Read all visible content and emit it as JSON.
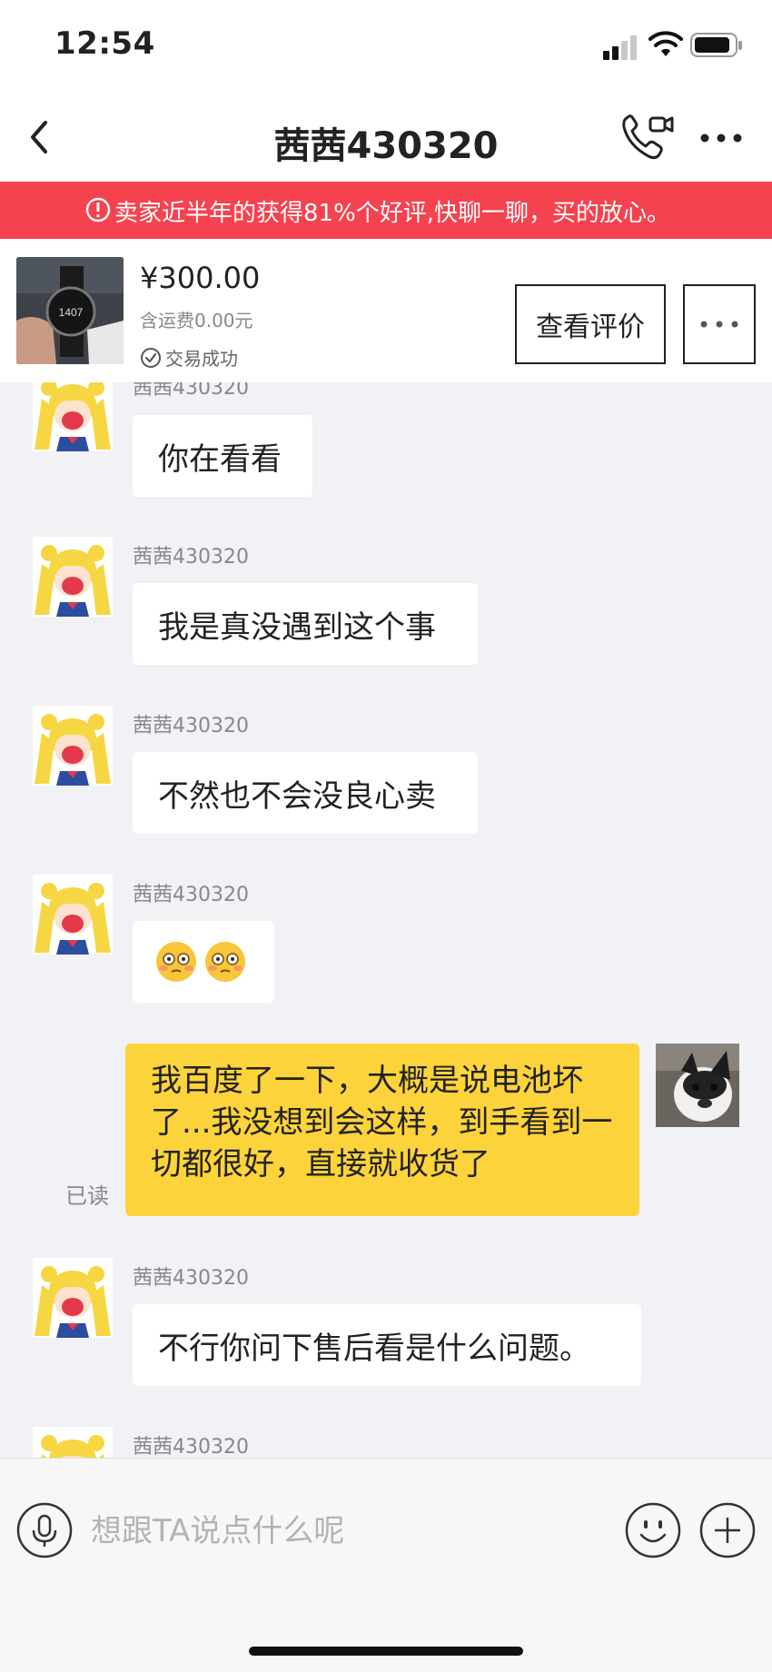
{
  "status_bar": {
    "time": "12:54"
  },
  "header": {
    "title": "茜茜430320"
  },
  "banner": {
    "text": "卖家近半年的获得81%个好评,快聊一聊，买的放心。"
  },
  "product": {
    "price": "¥300.00",
    "shipping": "含运费0.00元",
    "status": "交易成功",
    "review_button": "查看评价",
    "thumb_screen_text": "1407"
  },
  "messages": [
    {
      "sender": "茜茜430320",
      "text": "你在看看",
      "from": "other"
    },
    {
      "sender": "茜茜430320",
      "text": "我是真没遇到这个事",
      "from": "other"
    },
    {
      "sender": "茜茜430320",
      "text": "不然也不会没良心卖",
      "from": "other"
    },
    {
      "sender": "茜茜430320",
      "text": "😳😳",
      "from": "other"
    },
    {
      "text": "我百度了一下，大概是说电池坏了...我没想到会这样，到手看到一切都很好，直接就收货了",
      "from": "me",
      "read_label": "已读"
    },
    {
      "sender": "茜茜430320",
      "text": "不行你问下售后看是什么问题。",
      "from": "other"
    },
    {
      "sender": "茜茜430320",
      "text": "",
      "from": "other"
    }
  ],
  "input": {
    "placeholder": "想跟TA说点什么呢"
  },
  "colors": {
    "banner": "#f5424f",
    "my_bubble": "#fcd33a",
    "chat_bg": "#f0f2f5"
  },
  "icons": [
    "back-arrow-icon",
    "video-call-icon",
    "more-dots-icon",
    "alert-circle-icon",
    "check-circle-icon",
    "microphone-icon",
    "emoji-icon",
    "plus-icon"
  ]
}
